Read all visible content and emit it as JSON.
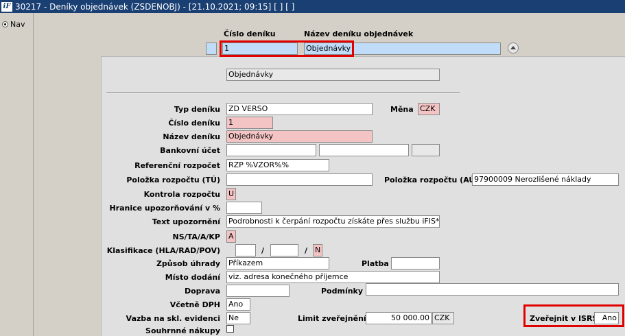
{
  "window": {
    "logo": "iF",
    "title": "30217 - Deníky objednávek (ZSDENOBJ) - [21.10.2021; 09:15]  [ ]  [ ]"
  },
  "left_panel": {
    "radio_label": "Nav"
  },
  "header": {
    "col_number_label": "Číslo deníku",
    "col_name_label": "Název deníku objednávek",
    "number_value": "1",
    "name_value": "Objednávky"
  },
  "summary_field": "Objednávky",
  "form": {
    "typ_deniku": {
      "label": "Typ deníku",
      "value": "ZD VERSO"
    },
    "mena": {
      "label": "Měna",
      "value": "CZK"
    },
    "cislo_deniku": {
      "label": "Číslo deníku",
      "value": "1"
    },
    "nazev_deniku": {
      "label": "Název deníku",
      "value": "Objednávky"
    },
    "bankovni_ucet": {
      "label": "Bankovní účet",
      "value1": "",
      "value2": "",
      "value3": ""
    },
    "referencni_rozpocet": {
      "label": "Referenční rozpočet",
      "value": "RZP %VZOR%%"
    },
    "polozka_tu": {
      "label": "Položka rozpočtu (TÚ)",
      "value": ""
    },
    "polozka_au": {
      "label": "Položka rozpočtu (AÚ)",
      "value": "97900009 Nerozlišené náklady"
    },
    "kontrola_rozpoctu": {
      "label": "Kontrola rozpočtu",
      "value": "U"
    },
    "hranice": {
      "label": "Hranice upozorňování v %",
      "value": ""
    },
    "text_upozorneni": {
      "label": "Text upozornění",
      "value": "Podrobnosti k čerpání rozpočtu získáte přes službu iFIS*WebMa"
    },
    "ns_ta": {
      "label": "NS/TA/A/KP",
      "value": "A"
    },
    "klasifikace": {
      "label": "Klasifikace (HLA/RAD/POV)",
      "value1": "",
      "value2": "",
      "value3": "N",
      "sep": "/"
    },
    "zpusob_uhrady": {
      "label": "Způsob úhrady",
      "value": "Příkazem"
    },
    "platba": {
      "label": "Platba",
      "value": ""
    },
    "misto_dodani": {
      "label": "Místo dodání",
      "value": "viz. adresa konečného příjemce"
    },
    "doprava": {
      "label": "Doprava",
      "value": ""
    },
    "podminky": {
      "label": "Podmínky",
      "value": ""
    },
    "vcetne_dph": {
      "label": "Včetně DPH",
      "value": "Ano"
    },
    "vazba": {
      "label": "Vazba na skl. evidenci",
      "value": "Ne"
    },
    "limit": {
      "label": "Limit zveřejnění",
      "value": "50 000.00",
      "currency": "CZK"
    },
    "zverejnit": {
      "label": "Zveřejnit v ISRS",
      "value": "Ano"
    },
    "souhrnne": {
      "label": "Souhrnné nákupy",
      "checked": false
    }
  },
  "colors": {
    "titlebar": "#1a3f73",
    "required_field": "#f4c4c4",
    "selected_field": "#c0dcf8",
    "highlight": "#e00000"
  }
}
